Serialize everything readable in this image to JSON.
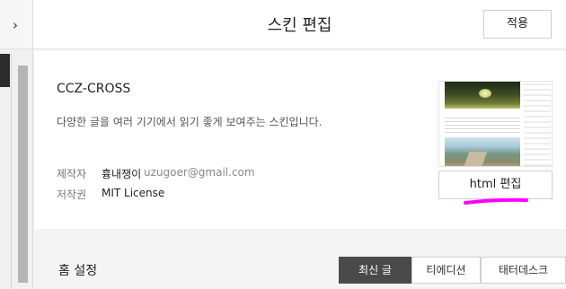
{
  "sidebar": {
    "toggle_icon": "chevron-right-icon",
    "toggle_glyph": "›"
  },
  "header": {
    "title": "스킨 편집",
    "apply_label": "적용"
  },
  "skin": {
    "name": "CCZ-CROSS",
    "description": "다양한 글을 여러 기기에서 읽기 좋게 보여주는 스킨입니다.",
    "author_label": "제작자",
    "author_name": "흉내쟁이",
    "author_email": "uzugoer@gmail.com",
    "license_label": "저작권",
    "license_value": "MIT License"
  },
  "edit": {
    "html_label": "html 편집",
    "annotation_color": "#ff00ff"
  },
  "home": {
    "title": "홈 설정",
    "options": [
      "최신 글",
      "티에디션",
      "태터데스크"
    ],
    "selected": "최신 글"
  },
  "colors": {
    "active_tab": "#4a4a4a",
    "border": "#cfcfcf"
  }
}
